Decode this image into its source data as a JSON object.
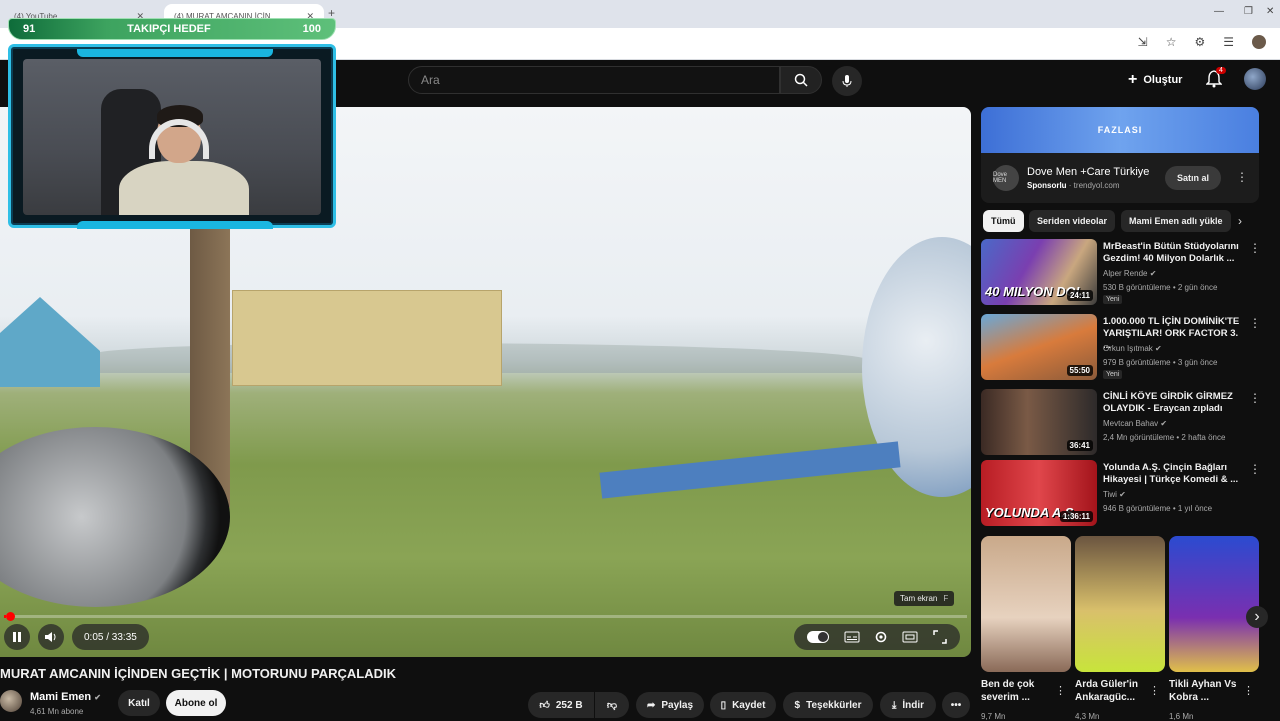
{
  "browser": {
    "tabs": [
      {
        "label": "(4) YouTube"
      },
      {
        "label": "(4) MURAT AMCANIN İÇİN"
      }
    ],
    "new_tab": "+"
  },
  "header": {
    "search_placeholder": "Ara",
    "create_label": "Oluştur",
    "notification_count": "4"
  },
  "overlay": {
    "left_value": "91",
    "goal_label": "TAKIPÇI HEDEF",
    "right_value": "100"
  },
  "player": {
    "fullscreen_tooltip": "Tam ekran",
    "fullscreen_key": "F",
    "time": "0:05 / 33:35",
    "progress_fraction": 0.0025
  },
  "video": {
    "title": "MURAT AMCANIN İÇİNDEN GEÇTİK | MOTORUNU PARÇALADIK",
    "channel_name": "Mami Emen",
    "subscribers": "4,61 Mn abone",
    "join_label": "Katıl",
    "subscribe_label": "Abone ol",
    "like_count": "252 B",
    "share_label": "Paylaş",
    "save_label": "Kaydet",
    "thanks_label": "Teşekkürler",
    "download_label": "İndir"
  },
  "ad": {
    "banner_text": "FAZLASI",
    "logo_text": "Dove MEN",
    "title": "Dove Men +Care Türkiye",
    "sponsored": "Sponsorlu",
    "domain": "· trendyol.com",
    "cta": "Satın al"
  },
  "chips": [
    "Tümü",
    "Seriden videolar",
    "Mami Emen adlı yükle"
  ],
  "recommendations": [
    {
      "title": "MrBeast'in Bütün Stüdyolarını Gezdim! 40 Milyon Dolarlık ...",
      "channel": "Alper Rende",
      "meta": "530 B görüntüleme • 2 gün önce",
      "badge": "Yeni",
      "duration": "24:11",
      "thumb_text": "40 MILYON DOL"
    },
    {
      "title": "1.000.000 TL İÇİN DOMİNİK'TE YARIŞTILAR! ORK FACTOR 3. ...",
      "channel": "Orkun Işıtmak",
      "meta": "979 B görüntüleme • 3 gün önce",
      "badge": "Yeni",
      "duration": "55:50",
      "thumb_text": ""
    },
    {
      "title": "CİNLİ KÖYE GİRDİK GİRMEZ OLAYDIK - Eraycan zıpladı",
      "channel": "Mevtcan Bahav",
      "meta": "2,4 Mn görüntüleme • 2 hafta önce",
      "badge": "",
      "duration": "36:41",
      "thumb_text": ""
    },
    {
      "title": "Yolunda A.Ş. Çinçin Bağları Hikayesi | Türkçe Komedi & ...",
      "channel": "Tiwi",
      "meta": "946 B görüntüleme • 1 yıl önce",
      "badge": "",
      "duration": "1:36:11",
      "thumb_text": "YOLUNDA A.Ş"
    }
  ],
  "shorts": [
    {
      "title": "Ben de çok severim ...",
      "views": "9,7 Mn"
    },
    {
      "title": "Arda Güler'in Ankaragüc...",
      "views": "4,3 Mn"
    },
    {
      "title": "Tikli Ayhan Vs Kobra ...",
      "views": "1,6 Mn"
    }
  ]
}
